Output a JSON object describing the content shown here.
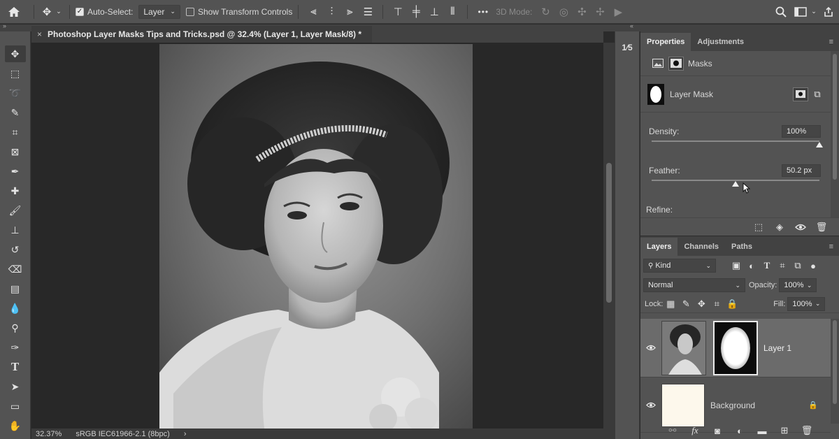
{
  "options_bar": {
    "home_icon": "home-icon",
    "auto_select_label": "Auto-Select:",
    "auto_select_checked": true,
    "auto_select_target": "Layer",
    "show_transform_label": "Show Transform Controls",
    "show_transform_checked": false,
    "more_label": "•••",
    "mode_3d_label": "3D Mode:"
  },
  "document": {
    "tab_title": "Photoshop Layer Masks Tips and Tricks.psd @ 32.4% (Layer 1, Layer Mask/8) *",
    "close_glyph": "×"
  },
  "status": {
    "zoom": "32.37%",
    "profile": "sRGB IEC61966-2.1 (8bpc)",
    "arrow": "›"
  },
  "properties": {
    "tabs": [
      "Properties",
      "Adjustments"
    ],
    "section_label": "Masks",
    "mask_type": "Layer Mask",
    "density_label": "Density:",
    "density_value": "100%",
    "density_fraction": 1.0,
    "feather_label": "Feather:",
    "feather_value": "50.2 px",
    "feather_fraction": 0.5,
    "refine_label": "Refine:"
  },
  "layers": {
    "tabs": [
      "Layers",
      "Channels",
      "Paths"
    ],
    "filter_kind": "Kind",
    "blend_mode": "Normal",
    "opacity_label": "Opacity:",
    "opacity_value": "100%",
    "lock_label": "Lock:",
    "fill_label": "Fill:",
    "fill_value": "100%",
    "items": [
      {
        "name": "Layer 1",
        "visible": true,
        "selected": true
      },
      {
        "name": "Background",
        "visible": true,
        "selected": false,
        "locked": true
      }
    ],
    "fx_label": "fx"
  },
  "colors": {
    "panel_bg": "#535353",
    "canvas_bg": "#282828",
    "selected_layer": "#6b6b6b",
    "background_fill": "#fdf8ec"
  }
}
